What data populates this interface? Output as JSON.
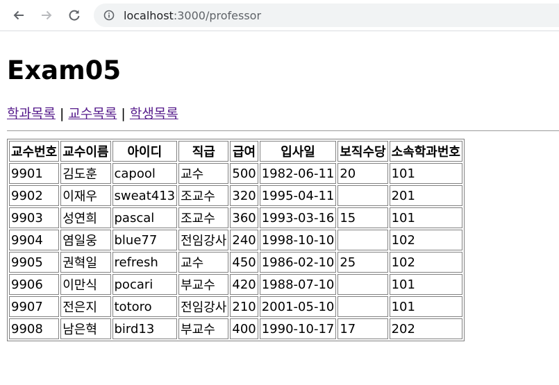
{
  "browser": {
    "url_host": "localhost",
    "url_path": ":3000/professor"
  },
  "page": {
    "title": "Exam05",
    "nav": [
      {
        "label": "학과목록"
      },
      {
        "label": "교수목록"
      },
      {
        "label": "학생목록"
      }
    ],
    "separator": "|"
  },
  "table": {
    "headers": [
      "교수번호",
      "교수이름",
      "아이디",
      "직급",
      "급여",
      "입사일",
      "보직수당",
      "소속학과번호"
    ],
    "rows": [
      [
        "9901",
        "김도훈",
        "capool",
        "교수",
        "500",
        "1982-06-11",
        "20",
        "101"
      ],
      [
        "9902",
        "이재우",
        "sweat413",
        "조교수",
        "320",
        "1995-04-11",
        "",
        "201"
      ],
      [
        "9903",
        "성연희",
        "pascal",
        "조교수",
        "360",
        "1993-03-16",
        "15",
        "101"
      ],
      [
        "9904",
        "염일웅",
        "blue77",
        "전임강사",
        "240",
        "1998-10-10",
        "",
        "102"
      ],
      [
        "9905",
        "권혁일",
        "refresh",
        "교수",
        "450",
        "1986-02-10",
        "25",
        "102"
      ],
      [
        "9906",
        "이만식",
        "pocari",
        "부교수",
        "420",
        "1988-07-10",
        "",
        "101"
      ],
      [
        "9907",
        "전은지",
        "totoro",
        "전임강사",
        "210",
        "2001-05-10",
        "",
        "101"
      ],
      [
        "9908",
        "남은혁",
        "bird13",
        "부교수",
        "400",
        "1990-10-17",
        "17",
        "202"
      ]
    ]
  }
}
